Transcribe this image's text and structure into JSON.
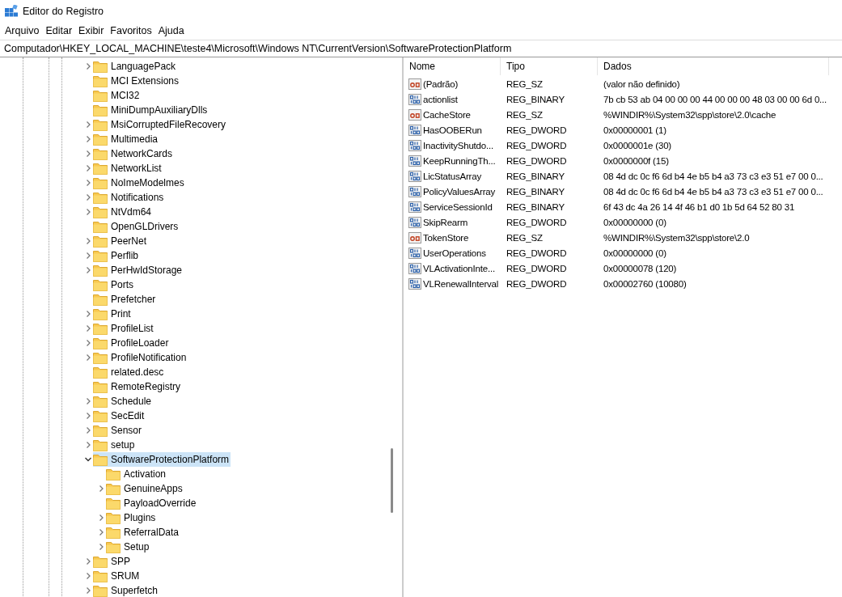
{
  "window": {
    "title": "Editor do Registro"
  },
  "menu": [
    "Arquivo",
    "Editar",
    "Exibir",
    "Favoritos",
    "Ajuda"
  ],
  "address": "Computador\\HKEY_LOCAL_MACHINE\\teste4\\Microsoft\\Windows NT\\CurrentVersion\\SoftwareProtectionPlatform",
  "tree": {
    "items": [
      {
        "label": "LanguagePack",
        "kind": "collapsed",
        "selected": false
      },
      {
        "label": "MCI Extensions",
        "kind": "leaf",
        "selected": false
      },
      {
        "label": "MCI32",
        "kind": "leaf",
        "selected": false
      },
      {
        "label": "MiniDumpAuxiliaryDlls",
        "kind": "leaf",
        "selected": false
      },
      {
        "label": "MsiCorruptedFileRecovery",
        "kind": "collapsed",
        "selected": false
      },
      {
        "label": "Multimedia",
        "kind": "collapsed",
        "selected": false
      },
      {
        "label": "NetworkCards",
        "kind": "collapsed",
        "selected": false
      },
      {
        "label": "NetworkList",
        "kind": "collapsed",
        "selected": false
      },
      {
        "label": "NoImeModelmes",
        "kind": "collapsed",
        "selected": false
      },
      {
        "label": "Notifications",
        "kind": "collapsed",
        "selected": false
      },
      {
        "label": "NtVdm64",
        "kind": "collapsed",
        "selected": false
      },
      {
        "label": "OpenGLDrivers",
        "kind": "leaf",
        "selected": false
      },
      {
        "label": "PeerNet",
        "kind": "collapsed",
        "selected": false
      },
      {
        "label": "Perflib",
        "kind": "collapsed",
        "selected": false
      },
      {
        "label": "PerHwIdStorage",
        "kind": "collapsed",
        "selected": false
      },
      {
        "label": "Ports",
        "kind": "leaf",
        "selected": false
      },
      {
        "label": "Prefetcher",
        "kind": "leaf",
        "selected": false
      },
      {
        "label": "Print",
        "kind": "collapsed",
        "selected": false
      },
      {
        "label": "ProfileList",
        "kind": "collapsed",
        "selected": false
      },
      {
        "label": "ProfileLoader",
        "kind": "collapsed",
        "selected": false
      },
      {
        "label": "ProfileNotification",
        "kind": "collapsed",
        "selected": false
      },
      {
        "label": "related.desc",
        "kind": "leaf",
        "selected": false
      },
      {
        "label": "RemoteRegistry",
        "kind": "leaf",
        "selected": false
      },
      {
        "label": "Schedule",
        "kind": "collapsed",
        "selected": false
      },
      {
        "label": "SecEdit",
        "kind": "collapsed",
        "selected": false
      },
      {
        "label": "Sensor",
        "kind": "collapsed",
        "selected": false
      },
      {
        "label": "setup",
        "kind": "collapsed",
        "selected": false
      },
      {
        "label": "SoftwareProtectionPlatform",
        "kind": "expanded",
        "selected": true,
        "children": [
          {
            "label": "Activation",
            "kind": "leaf",
            "selected": false
          },
          {
            "label": "GenuineApps",
            "kind": "collapsed",
            "selected": false
          },
          {
            "label": "PayloadOverride",
            "kind": "leaf",
            "selected": false
          },
          {
            "label": "Plugins",
            "kind": "collapsed",
            "selected": false
          },
          {
            "label": "ReferralData",
            "kind": "collapsed",
            "selected": false
          },
          {
            "label": "Setup",
            "kind": "collapsed",
            "selected": false
          }
        ]
      },
      {
        "label": "SPP",
        "kind": "collapsed",
        "selected": false
      },
      {
        "label": "SRUM",
        "kind": "collapsed",
        "selected": false
      },
      {
        "label": "Superfetch",
        "kind": "collapsed",
        "selected": false
      }
    ]
  },
  "values": {
    "columns": [
      "Nome",
      "Tipo",
      "Dados"
    ],
    "rows": [
      {
        "kind": "string",
        "name": "(Padrão)",
        "type": "REG_SZ",
        "data": "(valor não definido)"
      },
      {
        "kind": "binary",
        "name": "actionlist",
        "type": "REG_BINARY",
        "data": "7b cb 53 ab 04 00 00 00 44 00 00 00 48 03 00 00 6d 0..."
      },
      {
        "kind": "string",
        "name": "CacheStore",
        "type": "REG_SZ",
        "data": "%WINDIR%\\System32\\spp\\store\\2.0\\cache"
      },
      {
        "kind": "binary",
        "name": "HasOOBERun",
        "type": "REG_DWORD",
        "data": "0x00000001 (1)"
      },
      {
        "kind": "binary",
        "name": "InactivityShutdo...",
        "type": "REG_DWORD",
        "data": "0x0000001e (30)"
      },
      {
        "kind": "binary",
        "name": "KeepRunningTh...",
        "type": "REG_DWORD",
        "data": "0x0000000f (15)"
      },
      {
        "kind": "binary",
        "name": "LicStatusArray",
        "type": "REG_BINARY",
        "data": "08 4d dc 0c f6 6d b4 4e b5 b4 a3 73 c3 e3 51 e7 00 0..."
      },
      {
        "kind": "binary",
        "name": "PolicyValuesArray",
        "type": "REG_BINARY",
        "data": "08 4d dc 0c f6 6d b4 4e b5 b4 a3 73 c3 e3 51 e7 00 0..."
      },
      {
        "kind": "binary",
        "name": "ServiceSessionId",
        "type": "REG_BINARY",
        "data": "6f 43 dc 4a 26 14 4f 46 b1 d0 1b 5d 64 52 80 31"
      },
      {
        "kind": "binary",
        "name": "SkipRearm",
        "type": "REG_DWORD",
        "data": "0x00000000 (0)"
      },
      {
        "kind": "string",
        "name": "TokenStore",
        "type": "REG_SZ",
        "data": "%WINDIR%\\System32\\spp\\store\\2.0"
      },
      {
        "kind": "binary",
        "name": "UserOperations",
        "type": "REG_DWORD",
        "data": "0x00000000 (0)"
      },
      {
        "kind": "binary",
        "name": "VLActivationInte...",
        "type": "REG_DWORD",
        "data": "0x00000078 (120)"
      },
      {
        "kind": "binary",
        "name": "VLRenewalInterval",
        "type": "REG_DWORD",
        "data": "0x00002760 (10080)"
      }
    ]
  }
}
